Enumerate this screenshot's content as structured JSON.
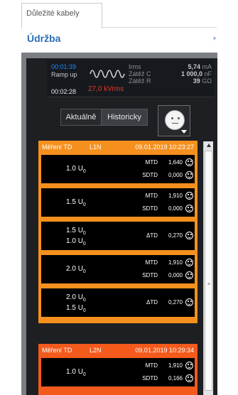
{
  "tab": {
    "label": "Důležité kabely"
  },
  "panel": {
    "title": "Údržba"
  },
  "status": {
    "time_elapsed": "00:01:39",
    "phase": "Ramp up",
    "time_total": "00:02:28",
    "voltage": "27,0 kVrms",
    "irms_label": "Irms",
    "irms_value": "5,74",
    "irms_unit": "mA",
    "zatez_c_label": "Zátěž C",
    "zatez_c_value": "1 000,0",
    "zatez_c_unit": "nF",
    "zatez_r_label": "Zátěž R",
    "zatez_r_value": "39",
    "zatez_r_unit": "GΩ"
  },
  "toggle": {
    "current": "Aktuálně",
    "history": "Historicky"
  },
  "cards": [
    {
      "name": "Měření TD",
      "phase": "L1N",
      "date": "09.01.2019 10:23:27",
      "color": "#f5901e",
      "rows": [
        {
          "u1": "1.0",
          "u2": "",
          "metrics": [
            {
              "k": "MTD",
              "v": "1,640"
            },
            {
              "k": "SDTD",
              "v": "0,000"
            }
          ]
        },
        {
          "u1": "1.5",
          "u2": "",
          "metrics": [
            {
              "k": "MTD",
              "v": "1,910"
            },
            {
              "k": "SDTD",
              "v": "0,000"
            }
          ]
        },
        {
          "u1": "1.5",
          "u2": "1.0",
          "metrics": [
            {
              "k": "ΔTD",
              "v": "0,270"
            }
          ]
        },
        {
          "u1": "2.0",
          "u2": "",
          "metrics": [
            {
              "k": "MTD",
              "v": "1,910"
            },
            {
              "k": "SDTD",
              "v": "0,000"
            }
          ]
        },
        {
          "u1": "2.0",
          "u2": "1.5",
          "metrics": [
            {
              "k": "ΔTD",
              "v": "0,270"
            }
          ]
        }
      ]
    },
    {
      "name": "Měření TD",
      "phase": "L2N",
      "date": "09.01.2019 10:29:34",
      "color": "#f35a1c",
      "rows": [
        {
          "u1": "1.0",
          "u2": "",
          "metrics": [
            {
              "k": "MTD",
              "v": "1,910"
            },
            {
              "k": "SDTD",
              "v": "0,166"
            }
          ]
        }
      ]
    }
  ],
  "unit_symbol": "U",
  "unit_sub": "0"
}
